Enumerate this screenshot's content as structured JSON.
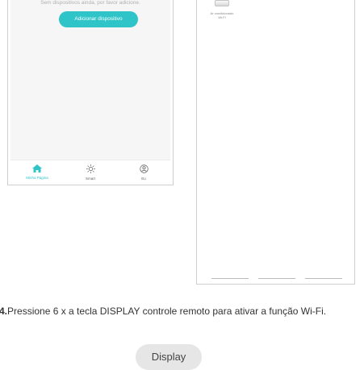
{
  "app_home": {
    "empty_message": "Sem dispositivos ainda, por favor adicione.",
    "add_button": "Adicionar dispositivo",
    "tabs": [
      {
        "label": "Minha Página",
        "icon": "home-icon",
        "active": true
      },
      {
        "label": "Smart",
        "icon": "sun-icon",
        "active": false
      },
      {
        "label": "Eu",
        "icon": "user-icon",
        "active": false
      }
    ],
    "accent_color": "#2fc4c8"
  },
  "device_list": {
    "device": {
      "name_line1": "Ar condicionado",
      "name_line2": "Wi-Fi",
      "icon": "air-conditioner-icon"
    }
  },
  "instruction": {
    "step": "4.",
    "text": "Pressione 6 x a tecla DISPLAY controle remoto para ativar a função Wi-Fi."
  },
  "remote_key": {
    "label": "Display"
  }
}
